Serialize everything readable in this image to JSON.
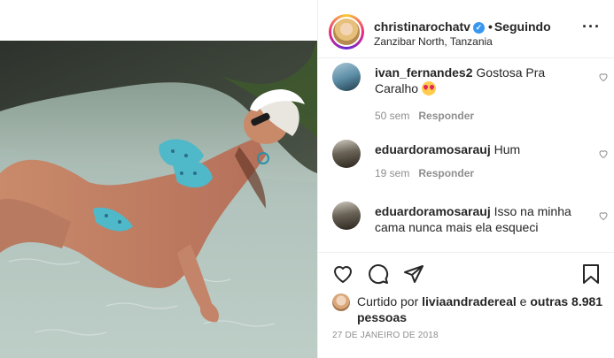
{
  "post": {
    "username": "christinarochatv",
    "verified_icon": "verified-badge-icon",
    "separator": "•",
    "follow_status": "Seguindo",
    "location": "Zanzibar North, Tanzania",
    "more_icon": "more-options-icon"
  },
  "comments": [
    {
      "user": "ivan_fernandes2",
      "text": "Gostosa Pra Caralho",
      "emoji": "heart-eyes-emoji",
      "time": "50 sem",
      "reply": "Responder"
    },
    {
      "user": "eduardoramosarauj",
      "text": "Hum",
      "time": "19 sem",
      "reply": "Responder"
    },
    {
      "user": "eduardoramosarauj",
      "text": "Isso na minha cama nunca mais ela esqueci"
    }
  ],
  "actions": {
    "like_icon": "heart-icon",
    "comment_icon": "comment-icon",
    "share_icon": "share-icon",
    "save_icon": "bookmark-icon"
  },
  "likes": {
    "prefix": "Curtido por",
    "user": "liviaandradereal",
    "connector": "e",
    "others": "outras 8.981 pessoas"
  },
  "date": "27 DE JANEIRO DE 2018",
  "colors": {
    "text": "#262626",
    "muted": "#8e8e8e",
    "verified": "#3897f0",
    "border": "#efefef"
  }
}
